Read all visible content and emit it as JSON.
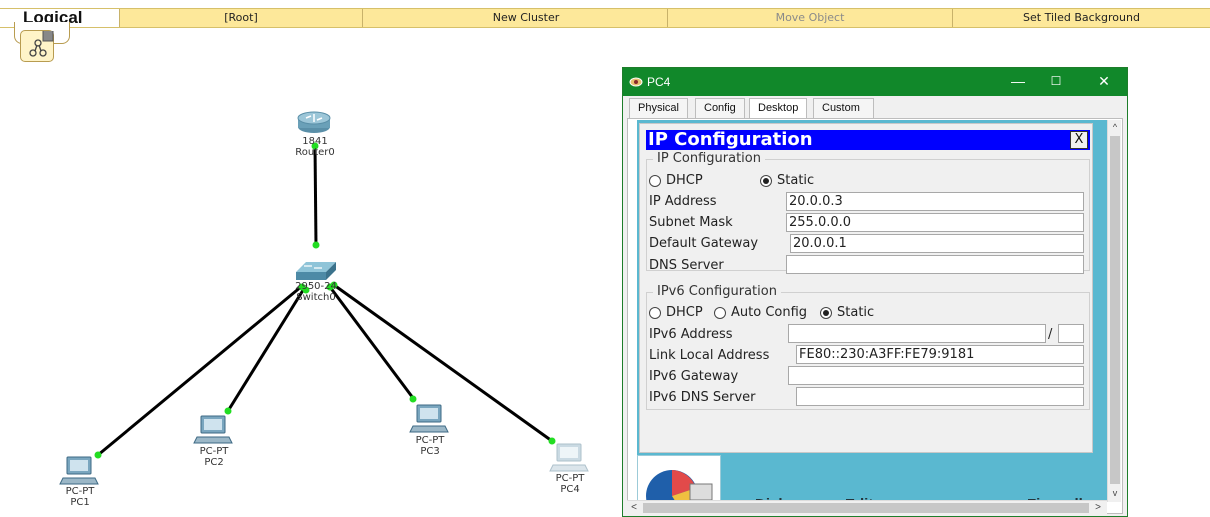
{
  "toolbar": {
    "logical": "Logical",
    "root": "[Root]",
    "new_cluster": "New Cluster",
    "move_object": "Move Object",
    "set_tiled_background": "Set Tiled Background"
  },
  "topology": {
    "router": {
      "model": "1841",
      "name": "Router0"
    },
    "switch": {
      "model": "2950-24",
      "name": "Switch0"
    },
    "pcs": [
      {
        "type": "PC-PT",
        "name": "PC1"
      },
      {
        "type": "PC-PT",
        "name": "PC2"
      },
      {
        "type": "PC-PT",
        "name": "PC3"
      },
      {
        "type": "PC-PT",
        "name": "PC4"
      }
    ],
    "colors": {
      "link": "#000000",
      "port": "#22dd22"
    }
  },
  "window": {
    "title": "PC4",
    "minimize": "—",
    "maximize": "☐",
    "close": "✕",
    "tabs": [
      "Physical",
      "Config",
      "Desktop",
      "Custom Interface"
    ],
    "active_tab": "Desktop",
    "background_labels": [
      "Dialer",
      "Editor",
      "Firewall"
    ]
  },
  "ipconfig": {
    "title": "IP Configuration",
    "close": "X",
    "ipv4": {
      "group_title": "IP Configuration",
      "dhcp_label": "DHCP",
      "static_label": "Static",
      "mode": "Static",
      "ip_address_label": "IP Address",
      "ip_address": "20.0.0.3",
      "subnet_mask_label": "Subnet Mask",
      "subnet_mask": "255.0.0.0",
      "gateway_label": "Default Gateway",
      "gateway": "20.0.0.1",
      "dns_label": "DNS Server",
      "dns": ""
    },
    "ipv6": {
      "group_title": "IPv6 Configuration",
      "dhcp_label": "DHCP",
      "auto_label": "Auto Config",
      "static_label": "Static",
      "mode": "Static",
      "address_label": "IPv6 Address",
      "address": "",
      "prefix_sep": "/",
      "prefix": "",
      "link_local_label": "Link Local Address",
      "link_local": "FE80::230:A3FF:FE79:9181",
      "gateway_label": "IPv6 Gateway",
      "gateway": "",
      "dns_label": "IPv6 DNS Server",
      "dns": ""
    }
  }
}
